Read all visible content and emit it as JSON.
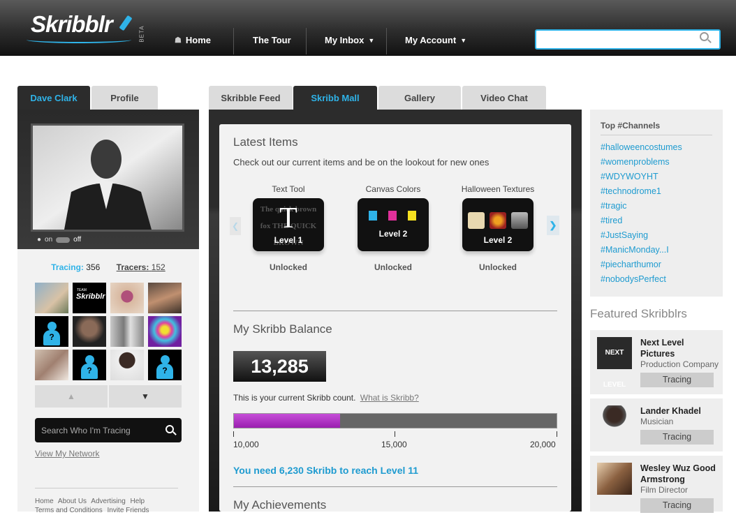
{
  "header": {
    "logo": "Skribblr",
    "beta": "BETA",
    "nav": {
      "home": "Home",
      "tour": "The Tour",
      "inbox": "My Inbox",
      "account": "My Account"
    },
    "search_value": ""
  },
  "left_tabs": {
    "user": "Dave Clark",
    "profile": "Profile"
  },
  "presence": {
    "on": "on",
    "off": "off"
  },
  "counts": {
    "tracing_label": "Tracing:",
    "tracing": "356",
    "tracers_label": "Tracers:",
    "tracers": "152"
  },
  "network_search_placeholder": "Search Who I'm Tracing",
  "view_network": "View My Network",
  "footer": {
    "home": "Home",
    "about": "About Us",
    "advertising": "Advertising",
    "help": "Help",
    "terms": "Terms and Conditions",
    "invite": "Invite Friends"
  },
  "main_tabs": {
    "feed": "Skribble Feed",
    "mall": "Skribb Mall",
    "gallery": "Gallery",
    "video": "Video Chat"
  },
  "latest": {
    "title": "Latest Items",
    "subtitle": "Check out our current items and be on the lookout for new ones",
    "items": [
      {
        "name": "Text Tool",
        "level": "Level 1",
        "status": "Unlocked",
        "glyph": "T",
        "sample": "The quick brown fox THE QUICK BROWN"
      },
      {
        "name": "Canvas Colors",
        "level": "Level 2",
        "status": "Unlocked"
      },
      {
        "name": "Halloween Textures",
        "level": "Level 2",
        "status": "Unlocked"
      }
    ]
  },
  "balance": {
    "title": "My Skribb Balance",
    "value": "13,285",
    "note": "This is your current Skribb count.",
    "link": "What is Skribb?",
    "progress": 0.3285,
    "ticks": [
      "10,000",
      "15,000",
      "20,000"
    ],
    "need": "You need 6,230 Skribb to reach Level 11"
  },
  "achievements_title": "My Achievements",
  "channels": {
    "title": "Top #Channels",
    "items": [
      "#halloweencostumes",
      "#womenproblems",
      "#WDYWOYHT",
      "#technodrome1",
      "#tragic",
      "#tired",
      "#JustSaying",
      "#ManicMonday...I",
      "#piecharthumor",
      "#nobodysPerfect"
    ]
  },
  "featured": {
    "title": "Featured Skribblrs",
    "cards": [
      {
        "name": "Next Level Pictures",
        "role": "Production Company",
        "button": "Tracing",
        "pic_text": "NEXT LEVEL"
      },
      {
        "name": "Lander Khadel",
        "role": "Musician",
        "button": "Tracing"
      },
      {
        "name": "Wesley Wuz Good Armstrong",
        "role": "Film Director",
        "button": "Tracing"
      }
    ]
  },
  "thumb_team_text": "Skribblr",
  "thumb_team_small": "TEAM",
  "colors": {
    "accent": "#2fb3e8",
    "progress": "#b23cc8"
  }
}
